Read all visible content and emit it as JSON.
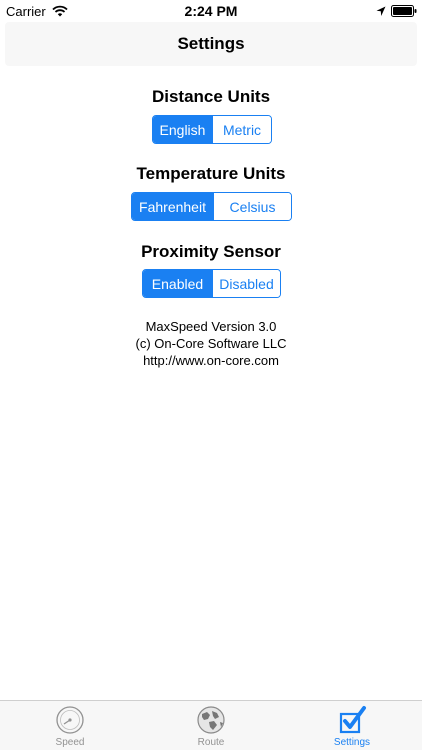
{
  "status_bar": {
    "carrier": "Carrier",
    "time": "2:24 PM",
    "icons": [
      "wifi-icon",
      "location-icon",
      "battery-icon"
    ]
  },
  "nav": {
    "title": "Settings"
  },
  "distance": {
    "title": "Distance Units",
    "options": [
      "English",
      "Metric"
    ],
    "selected": "English"
  },
  "temperature": {
    "title": "Temperature Units",
    "options": [
      "Fahrenheit",
      "Celsius"
    ],
    "selected": "Fahrenheit"
  },
  "proximity": {
    "title": "Proximity Sensor",
    "options": [
      "Enabled",
      "Disabled"
    ],
    "selected": "Enabled"
  },
  "about": {
    "version": "MaxSpeed Version 3.0",
    "copyright": "(c) On-Core Software LLC",
    "url": "http://www.on-core.com"
  },
  "tabs": [
    {
      "label": "Speed",
      "icon": "speedometer-icon"
    },
    {
      "label": "Route",
      "icon": "globe-icon"
    },
    {
      "label": "Settings",
      "icon": "checkbox-icon",
      "active": true
    }
  ],
  "colors": {
    "accent": "#1a80f2",
    "inactive_tab": "#929292",
    "bar_background": "#f7f7f7"
  }
}
